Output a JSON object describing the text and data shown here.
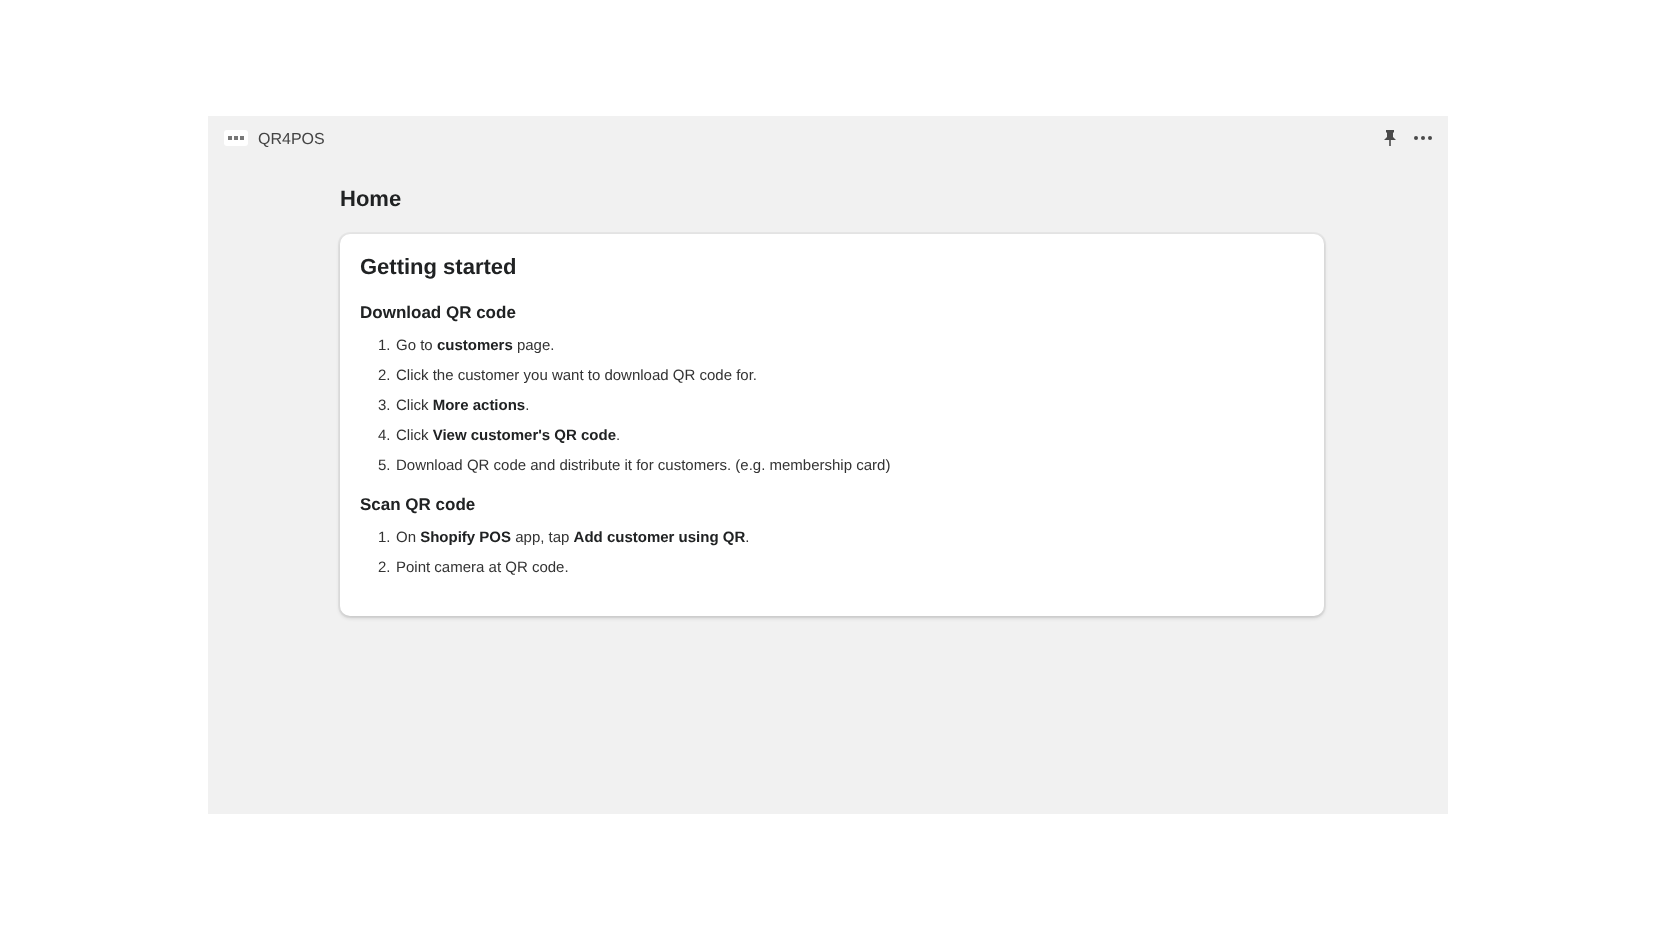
{
  "app_bar": {
    "title": "QR4POS"
  },
  "page": {
    "title": "Home"
  },
  "card": {
    "title": "Getting started",
    "sections": [
      {
        "heading": "Download QR code",
        "steps": [
          {
            "number": "1.",
            "text": "Go to **customers** page."
          },
          {
            "number": "2.",
            "text": "Click the customer you want to download QR code for."
          },
          {
            "number": "3.",
            "text": "Click **More actions**."
          },
          {
            "number": "4.",
            "text": "Click **View customer's QR code**."
          },
          {
            "number": "5.",
            "text": "Download QR code and distribute it for customers. (e.g. membership card)"
          }
        ]
      },
      {
        "heading": "Scan QR code",
        "steps": [
          {
            "number": "1.",
            "text": "On **Shopify POS** app, tap **Add customer using QR**."
          },
          {
            "number": "2.",
            "text": "Point camera at QR code."
          }
        ]
      }
    ]
  }
}
